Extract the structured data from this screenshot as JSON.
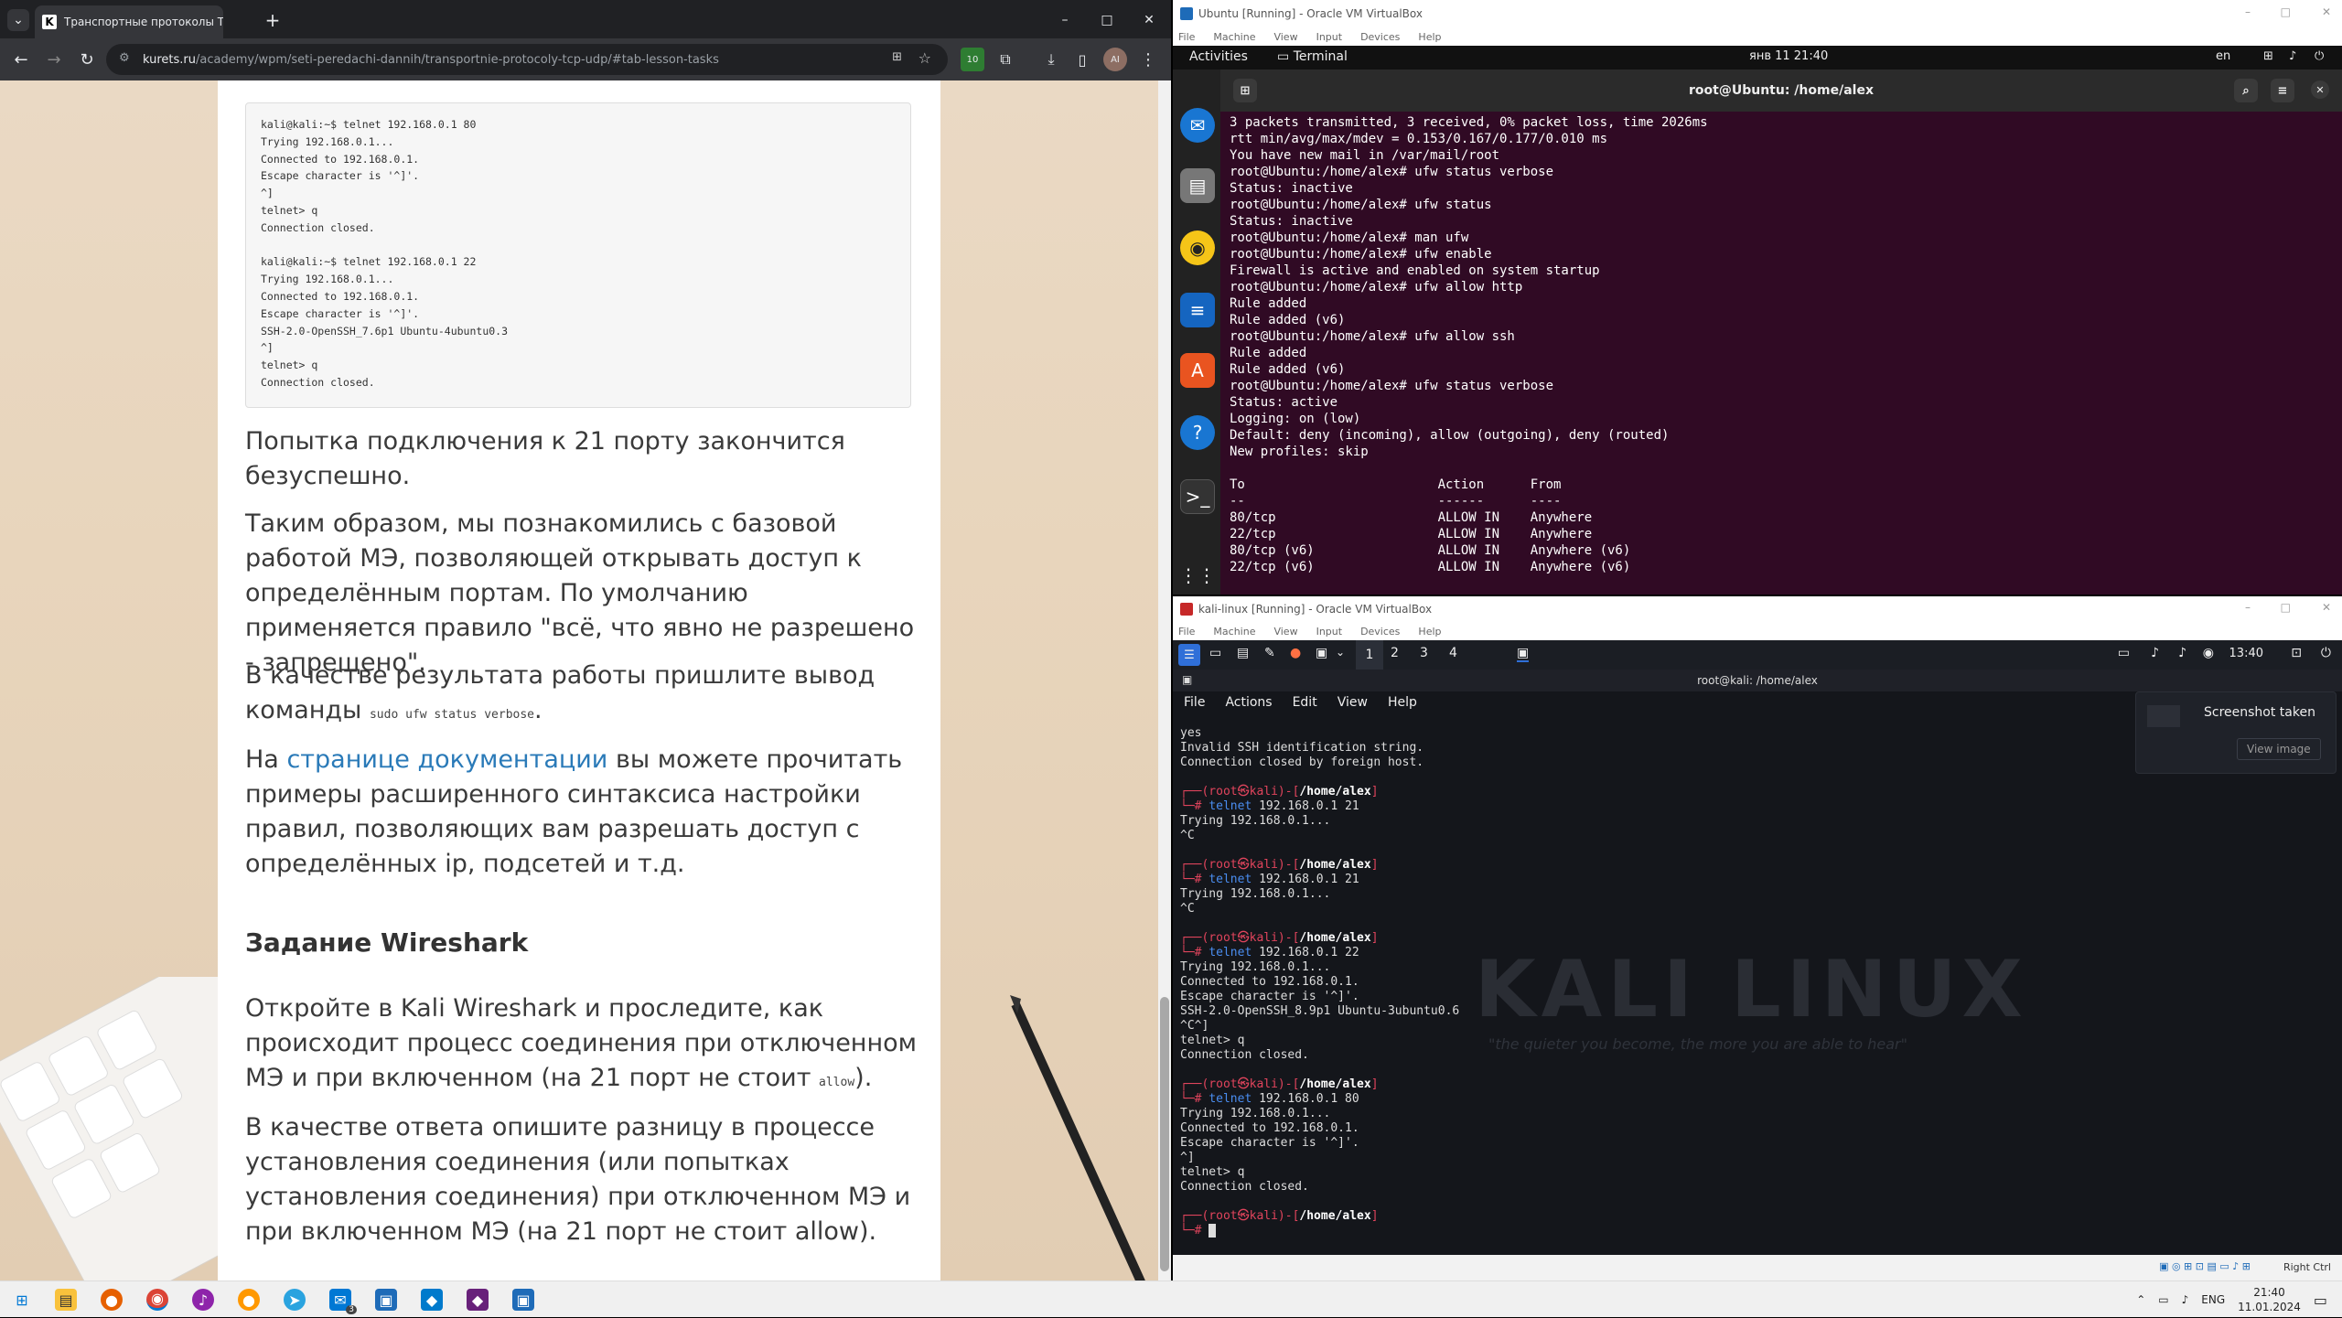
{
  "browser": {
    "tab_title": "Транспортные протоколы TCP",
    "new_tab": "+",
    "url_domain": "kurets.ru",
    "url_rest": "/academy/wpm/seti-peredachi-dannih/transportnie-protocoly-tcp-udp/#tab-lesson-tasks",
    "profile_initials": "AI",
    "badge": "10",
    "window_minimize": "–",
    "window_restore": "□",
    "window_close": "✕"
  },
  "article": {
    "code_block": "kali@kali:~$ telnet 192.168.0.1 80\nTrying 192.168.0.1...\nConnected to 192.168.0.1.\nEscape character is '^]'.\n^]\ntelnet> q\nConnection closed.\n\nkali@kali:~$ telnet 192.168.0.1 22\nTrying 192.168.0.1...\nConnected to 192.168.0.1.\nEscape character is '^]'.\nSSH-2.0-OpenSSH_7.6p1 Ubuntu-4ubuntu0.3\n^]\ntelnet> q\nConnection closed.",
    "p1": "Попытка подключения к 21 порту закончится безуспешно.",
    "p2": "Таким образом, мы познакомились с базовой работой МЭ, позволяющей открывать доступ к определённым портам. По умолчанию применяется правило \"всё, что явно не разрешено - запрещено\".",
    "p3_text": "В качестве результата работы пришлите вывод команды",
    "p3_code": "sudo ufw status verbose",
    "p3_end": ".",
    "p4_pre": "На",
    "p4_link": "странице документации",
    "p4_post": "вы можете прочитать примеры расширенного синтаксиса настройки правил, позволяющих вам разрешать доступ с определённых ip, подсетей и т.д.",
    "heading": "Задание Wireshark",
    "p5_text": "Откройте в Kali Wireshark и проследите, как происходит процесс соединения при отключенном МЭ и при включенном (на 21 порт не стоит",
    "p5_code": "allow",
    "p5_end": ").",
    "p6": "В качестве ответа опишите разницу в процессе установления соединения (или попытках установления соединения) при отключенном МЭ и при включенном МЭ (на 21 порт не стоит allow)."
  },
  "ubuntu_vm": {
    "window_title": "Ubuntu [Running] - Oracle VM VirtualBox",
    "menu": [
      "File",
      "Machine",
      "View",
      "Input",
      "Devices",
      "Help"
    ],
    "activities": "Activities",
    "app_name": "Terminal",
    "clock": "янв 11  21:40",
    "lang": "en",
    "terminal_title": "root@Ubuntu: /home/alex",
    "terminal_output": "3 packets transmitted, 3 received, 0% packet loss, time 2026ms\nrtt min/avg/max/mdev = 0.153/0.167/0.177/0.010 ms\nYou have new mail in /var/mail/root\nroot@Ubuntu:/home/alex# ufw status verbose\nStatus: inactive\nroot@Ubuntu:/home/alex# ufw status\nStatus: inactive\nroot@Ubuntu:/home/alex# man ufw\nroot@Ubuntu:/home/alex# ufw enable\nFirewall is active and enabled on system startup\nroot@Ubuntu:/home/alex# ufw allow http\nRule added\nRule added (v6)\nroot@Ubuntu:/home/alex# ufw allow ssh\nRule added\nRule added (v6)\nroot@Ubuntu:/home/alex# ufw status verbose\nStatus: active\nLogging: on (low)\nDefault: deny (incoming), allow (outgoing), deny (routed)\nNew profiles: skip\n\nTo                         Action      From\n--                         ------      ----\n80/tcp                     ALLOW IN    Anywhere\n22/tcp                     ALLOW IN    Anywhere\n80/tcp (v6)                ALLOW IN    Anywhere (v6)\n22/tcp (v6)                ALLOW IN    Anywhere (v6)"
  },
  "kali_vm": {
    "window_title": "kali-linux [Running] - Oracle VM VirtualBox",
    "menu": [
      "File",
      "Machine",
      "View",
      "Input",
      "Devices",
      "Help"
    ],
    "workspaces": [
      "1",
      "2",
      "3",
      "4"
    ],
    "clock": "13:40",
    "terminal_title": "root@kali: /home/alex",
    "term_menu": [
      "File",
      "Actions",
      "Edit",
      "View",
      "Help"
    ],
    "logo": "KALI LINUX",
    "tagline": "\"the quieter you become, the more you are able to hear\"",
    "notif_title": "Screenshot taken",
    "notif_button": "View image",
    "host_key": "Right Ctrl"
  },
  "taskbar": {
    "lang": "ENG",
    "time": "21:40",
    "date": "11.01.2024",
    "mail_badge": "3"
  }
}
